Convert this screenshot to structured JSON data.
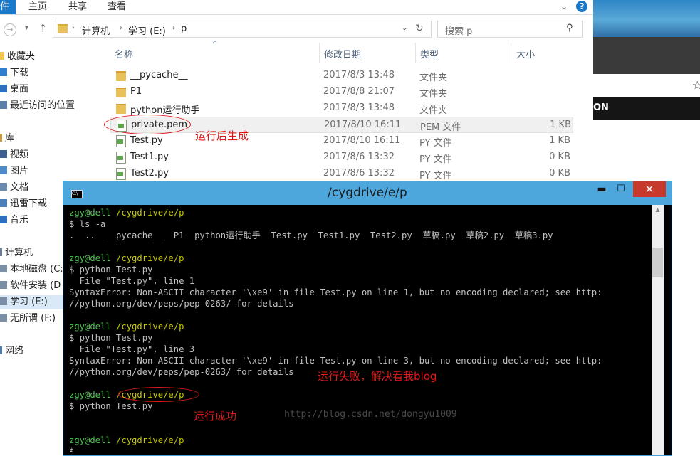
{
  "ribbon": {
    "file_tab": "件",
    "tabs": [
      "主页",
      "共享",
      "查看"
    ]
  },
  "address_bar": {
    "crumbs": [
      "计算机",
      "学习 (E:)",
      "p"
    ]
  },
  "search": {
    "placeholder": "搜索 p"
  },
  "nav_pane": {
    "items": [
      "收藏夹",
      "下载",
      "桌面",
      "最近访问的位置",
      "库",
      "视频",
      "图片",
      "文档",
      "迅雷下载",
      "音乐",
      "计算机",
      "本地磁盘 (C:",
      "软件安装 (D",
      "学习 (E:)",
      "无所谓 (F:)",
      "网络"
    ]
  },
  "columns": {
    "name": "名称",
    "date": "修改日期",
    "type": "类型",
    "size": "大小"
  },
  "files": [
    {
      "name": "__pycache__",
      "date": "2017/8/3 13:48",
      "type": "文件夹",
      "size": "",
      "kind": "folder"
    },
    {
      "name": "P1",
      "date": "2017/8/8 21:07",
      "type": "文件夹",
      "size": "",
      "kind": "folder"
    },
    {
      "name": "python运行助手",
      "date": "2017/8/3 13:48",
      "type": "文件夹",
      "size": "",
      "kind": "folder"
    },
    {
      "name": "private.pem",
      "date": "2017/8/10 16:11",
      "type": "PEM 文件",
      "size": "1 KB",
      "kind": "file"
    },
    {
      "name": "Test.py",
      "date": "2017/8/10 16:11",
      "type": "PY 文件",
      "size": "1 KB",
      "kind": "file"
    },
    {
      "name": "Test1.py",
      "date": "2017/8/6 13:32",
      "type": "PY 文件",
      "size": "0 KB",
      "kind": "file"
    },
    {
      "name": "Test2.py",
      "date": "2017/8/6 13:32",
      "type": "PY 文件",
      "size": "0 KB",
      "kind": "file"
    }
  ],
  "background_window": {
    "banner_text": "ON"
  },
  "terminal": {
    "title": "/cygdrive/e/p",
    "lines": [
      {
        "prompt_user": "zgy@dell",
        "prompt_path": "/cygdrive/e/p"
      },
      {
        "text": "$ ls -a"
      },
      {
        "text": ".  ..  __pycache__  P1  python运行助手  Test.py  Test1.py  Test2.py  草稿.py  草稿2.py  草稿3.py"
      },
      {
        "text": ""
      },
      {
        "prompt_user": "zgy@dell",
        "prompt_path": "/cygdrive/e/p"
      },
      {
        "text": "$ python Test.py"
      },
      {
        "text": "  File \"Test.py\", line 1"
      },
      {
        "text": "SyntaxError: Non-ASCII character '\\xe9' in file Test.py on line 1, but no encoding declared; see http:"
      },
      {
        "text": "//python.org/dev/peps/pep-0263/ for details"
      },
      {
        "text": ""
      },
      {
        "prompt_user": "zgy@dell",
        "prompt_path": "/cygdrive/e/p"
      },
      {
        "text": "$ python Test.py"
      },
      {
        "text": "  File \"Test.py\", line 3"
      },
      {
        "text": "SyntaxError: Non-ASCII character '\\xe9' in file Test.py on line 3, but no encoding declared; see http:"
      },
      {
        "text": "//python.org/dev/peps/pep-0263/ for details"
      },
      {
        "text": ""
      },
      {
        "prompt_user": "zgy@dell",
        "prompt_path": "/cygdrive/e/p"
      },
      {
        "text": "$ python Test.py"
      },
      {
        "text": ""
      },
      {
        "text": ""
      },
      {
        "prompt_user": "zgy@dell",
        "prompt_path": "/cygdrive/e/p"
      },
      {
        "text": "$"
      }
    ],
    "watermark": "http://blog.csdn.net/dongyu1009"
  },
  "annotations": {
    "generated": "运行后生成",
    "failed": "运行失败，解决看我blog",
    "success": "运行成功"
  },
  "colors": {
    "accent": "#1979ca",
    "annotation": "#e01818",
    "prompt_green": "#4ec34e",
    "prompt_yellow": "#c8c800"
  }
}
